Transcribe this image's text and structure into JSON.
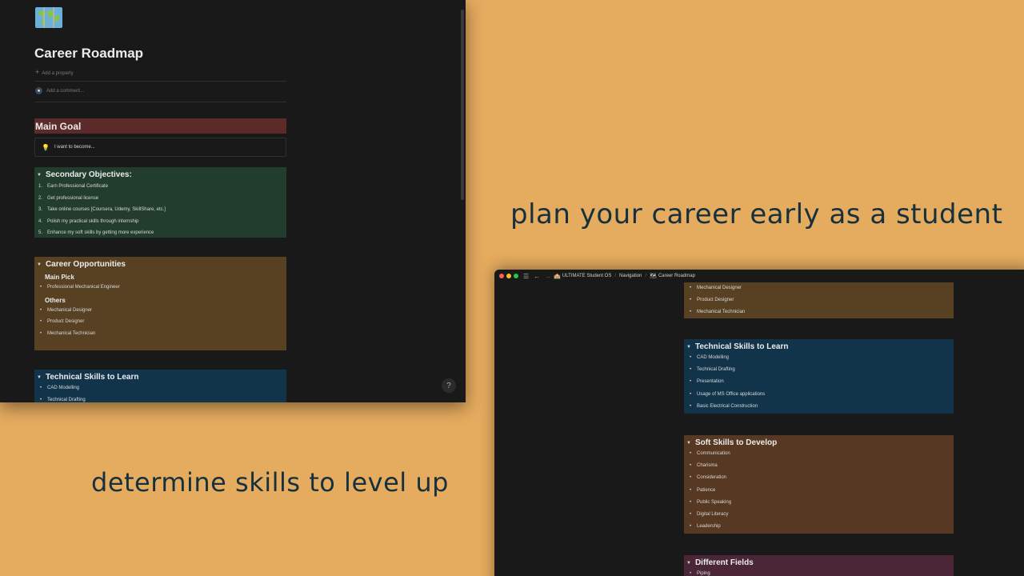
{
  "taglines": {
    "top": "plan your career early as a student",
    "bottom": "determine skills to level up"
  },
  "window_main": {
    "title": "Career Roadmap",
    "add_property": "Add a property",
    "add_comment": "Add a comment...",
    "main_goal": {
      "heading": "Main Goal",
      "callout": "I want to become..."
    },
    "secondary": {
      "heading": "Secondary Objectives:",
      "items": [
        "Earn Professional Certificate",
        "Get professional license",
        "Take online courses [Coursera, Udemy, SkillShare, etc.]",
        "Polish my practical skills through internship",
        "Enhance my soft skills by getting more experience"
      ]
    },
    "career": {
      "heading": "Career Opportunities",
      "main_pick_label": "Main Pick",
      "main_pick": [
        "Professional Mechanical Engineer"
      ],
      "others_label": "Others",
      "others": [
        "Mechanical Designer",
        "Product Designer",
        "Mechanical Technician"
      ]
    },
    "technical": {
      "heading": "Technical Skills to Learn",
      "items": [
        "CAD Modelling",
        "Technical Drafting"
      ]
    },
    "help": "?"
  },
  "window_second": {
    "breadcrumb": [
      "ULTIMATE Student OS",
      "Navigation",
      "Career Roadmap"
    ],
    "career_tail": [
      "Mechanical Designer",
      "Product Designer",
      "Mechanical Technician"
    ],
    "technical": {
      "heading": "Technical Skills to Learn",
      "items": [
        "CAD Modelling",
        "Technical Drafting",
        "Presentation",
        "Usage of MS Office applications",
        "Basic Electrical Construction"
      ]
    },
    "soft": {
      "heading": "Soft Skills to Develop",
      "items": [
        "Communication",
        "Charisma",
        "Consideration",
        "Patience",
        "Public Speaking",
        "Digital Literacy",
        "Leadership"
      ]
    },
    "fields": {
      "heading": "Different Fields",
      "items": [
        "Piping"
      ]
    }
  },
  "colors": {
    "background": "#e5ab5f",
    "text": "#16313d",
    "window": "#191919",
    "main_goal": "#5c2b29",
    "green": "#223d2e",
    "brown": "#574122",
    "blue": "#12344b",
    "rust": "#573822",
    "plum": "#4a2637"
  }
}
